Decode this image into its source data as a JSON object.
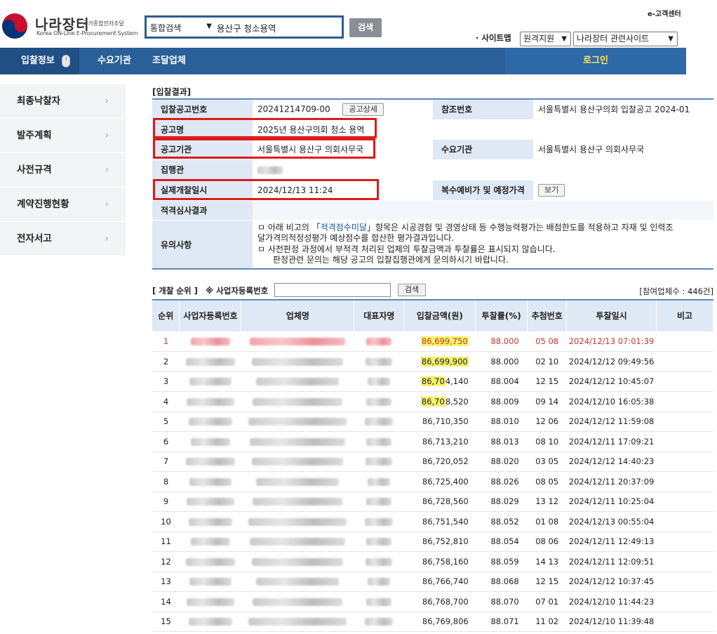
{
  "header": {
    "logo_title": "나라장터",
    "logo_sub_kr": "국가종합전자조달",
    "logo_sub_en": "Korea ON-Line E-Procurement System",
    "search_category": "통합검색",
    "search_query": "용산구 청소용역",
    "search_button": "검색",
    "customer_center": "e-고객센터",
    "sitemap": "· 사이트맵",
    "remote_support": "원격지원",
    "related_sites": "나라장터 관련사이트"
  },
  "nav": {
    "items": [
      "입찰정보",
      "수요기관",
      "조달업체"
    ],
    "login": "로그인"
  },
  "sidebar": {
    "items": [
      "최종낙찰자",
      "발주계획",
      "사전규격",
      "계약진행현황",
      "전자서고"
    ]
  },
  "result": {
    "section_title": "[입찰결과]",
    "bid_no_label": "입찰공고번호",
    "bid_no": "20241214709-00",
    "bid_detail_button": "공고상세",
    "ref_label": "참조번호",
    "ref_value": "서울특별시 용산구의회 입찰공고 2024-01",
    "name_label": "공고명",
    "name_value": "2025년 용산구의회 청소 용역",
    "org_label": "공고기관",
    "org_value": "서울특별시 용산구 의회사무국",
    "demand_label": "수요기관",
    "demand_value": "서울특별시 용산구 의회사무국",
    "exec_label": "집행관",
    "open_label": "실제개찰일시",
    "open_value": "2024/12/13 11:24",
    "price_label": "복수예비가 및 예정가격",
    "price_button": "보기",
    "qual_label": "적격심사결과",
    "notice_label": "유의사항",
    "notice_line1_pre": "ㅁ 아래 비고의 「",
    "notice_line1_hl": "적격점수미달",
    "notice_line1_post": "」항목은 시공경험 및 경영상태 등 수행능력평가는 배점한도를 적용하고 자재 및 인력조",
    "notice_line2": "달가격의적정성평가 예상점수를 합산한 평가결과입니다.",
    "notice_line3": "ㅁ 사전판정 과정에서 부적격 처리된 업체의 투찰금액과 투찰률은 표시되지 않습니다.",
    "notice_line4": "판정관련 문의는 해당 공고의 입찰집행관에게 문의하시기 바랍니다."
  },
  "ranking": {
    "title": "[ 개찰 순위 ]",
    "reg_label": "※ 사업자등록번호",
    "search_button": "검색",
    "count": "[참여업체수 : 446건]",
    "columns": [
      "순위",
      "사업자등록번호",
      "업체명",
      "대표자명",
      "입찰금액(원)",
      "투찰률(%)",
      "추첨번호",
      "투찰일시",
      "비고"
    ],
    "rows": [
      {
        "rank": "1",
        "amount": "86,699,750",
        "rate": "88.000",
        "lottery": "05 08",
        "time": "2024/12/13 07:01:39",
        "hl": "86,699,750",
        "rest": ""
      },
      {
        "rank": "2",
        "amount": "86,699,900",
        "rate": "88.000",
        "lottery": "02 10",
        "time": "2024/12/12 09:49:56",
        "hl": "86,699,900",
        "rest": ""
      },
      {
        "rank": "3",
        "amount": "86,704,140",
        "rate": "88.004",
        "lottery": "12 15",
        "time": "2024/12/12 10:45:07",
        "hl": "86,70",
        "rest": "4,140"
      },
      {
        "rank": "4",
        "amount": "86,708,520",
        "rate": "88.009",
        "lottery": "09 14",
        "time": "2024/12/10 16:05:38",
        "hl": "86,70",
        "rest": "8,520"
      },
      {
        "rank": "5",
        "amount": "86,710,350",
        "rate": "88.010",
        "lottery": "12 06",
        "time": "2024/12/12 11:59:08"
      },
      {
        "rank": "6",
        "amount": "86,713,210",
        "rate": "88.013",
        "lottery": "08 10",
        "time": "2024/12/11 17:09:21"
      },
      {
        "rank": "7",
        "amount": "86,720,052",
        "rate": "88.020",
        "lottery": "03 05",
        "time": "2024/12/12 14:40:23"
      },
      {
        "rank": "8",
        "amount": "86,725,400",
        "rate": "88.026",
        "lottery": "08 05",
        "time": "2024/12/11 20:37:09"
      },
      {
        "rank": "9",
        "amount": "86,728,560",
        "rate": "88.029",
        "lottery": "13 12",
        "time": "2024/12/11 10:25:04"
      },
      {
        "rank": "10",
        "amount": "86,751,540",
        "rate": "88.052",
        "lottery": "01 08",
        "time": "2024/12/13 00:55:04"
      },
      {
        "rank": "11",
        "amount": "86,752,810",
        "rate": "88.054",
        "lottery": "08 06",
        "time": "2024/12/11 12:49:13"
      },
      {
        "rank": "12",
        "amount": "86,758,160",
        "rate": "88.059",
        "lottery": "14 13",
        "time": "2024/12/11 12:09:51"
      },
      {
        "rank": "13",
        "amount": "86,766,740",
        "rate": "88.068",
        "lottery": "12 15",
        "time": "2024/12/12 10:37:45"
      },
      {
        "rank": "14",
        "amount": "86,768,700",
        "rate": "88.070",
        "lottery": "07 01",
        "time": "2024/12/10 11:44:23"
      },
      {
        "rank": "15",
        "amount": "86,769,806",
        "rate": "88.071",
        "lottery": "11 02",
        "time": "2024/12/10 11:39:48"
      }
    ]
  },
  "colors": {
    "nav_blue": "#2a5f99",
    "label_bg": "#dfe9f5",
    "highlight_box": "#e01a1a",
    "amount_highlight": "#f7f06a",
    "login_text": "#ffe35a",
    "first_row_text": "#c0392b"
  }
}
